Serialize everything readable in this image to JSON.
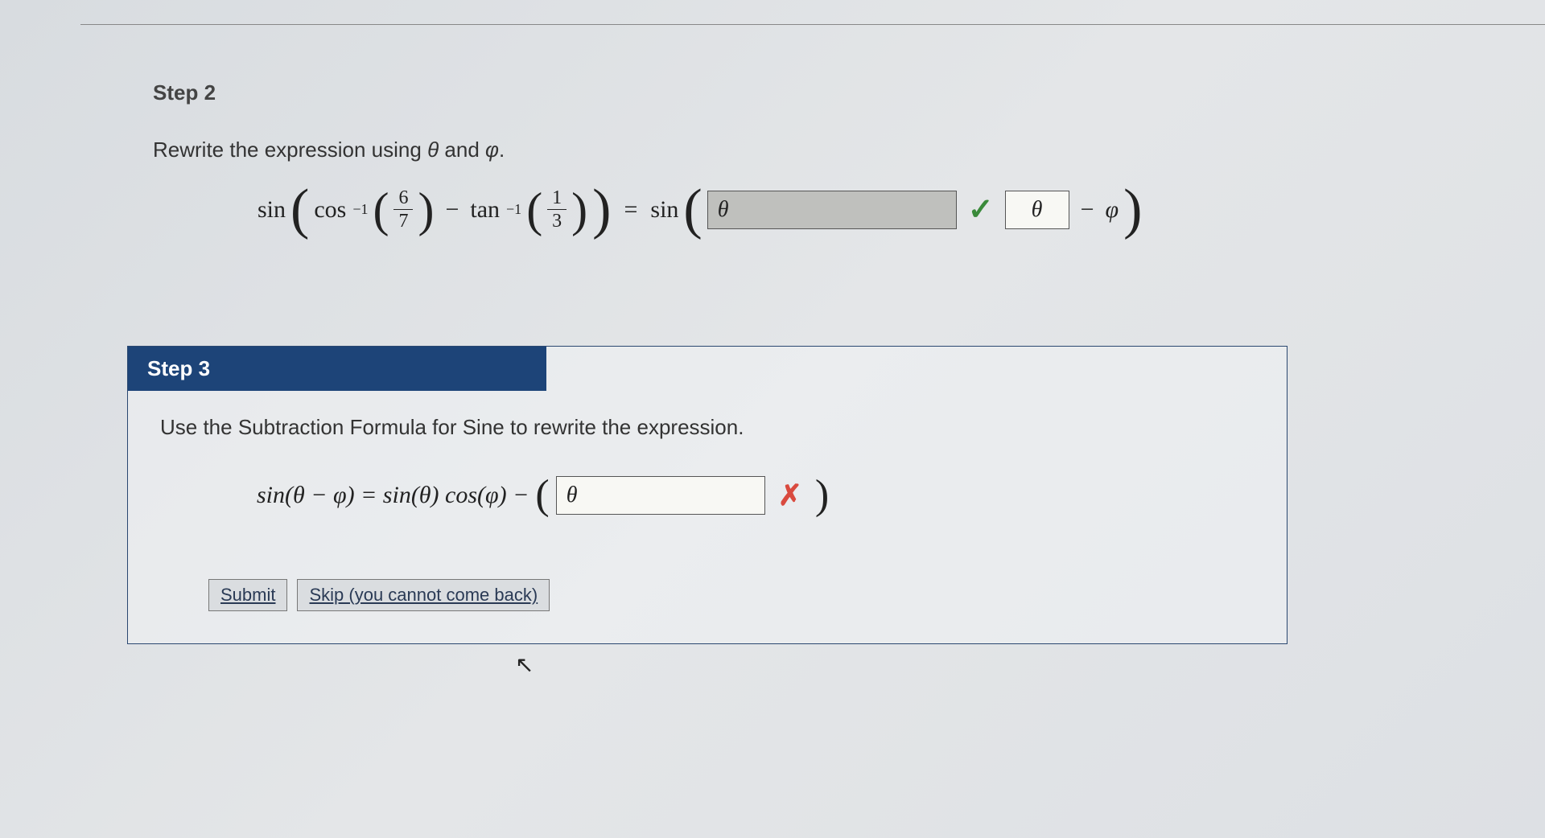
{
  "step2": {
    "title": "Step 2",
    "instruction_pre": "Rewrite the expression using ",
    "theta": "θ",
    "and": " and ",
    "phi": "φ",
    "period": ".",
    "math": {
      "sin": "sin",
      "cos": "cos",
      "inv": "−1",
      "frac1_num": "6",
      "frac1_den": "7",
      "minus": "−",
      "tan": "tan",
      "frac2_num": "1",
      "frac2_den": "3",
      "eq": "=",
      "input1_value": "θ",
      "input2_value": "θ",
      "minus2": "−",
      "phi": "φ"
    }
  },
  "step3": {
    "title": "Step 3",
    "instruction": "Use the Subtraction Formula for Sine to rewrite the expression.",
    "math": {
      "lhs": "sin(θ − φ) = sin(θ) cos(φ) −",
      "input_value": "θ"
    }
  },
  "buttons": {
    "submit": "Submit",
    "skip": "Skip (you cannot come back)"
  }
}
